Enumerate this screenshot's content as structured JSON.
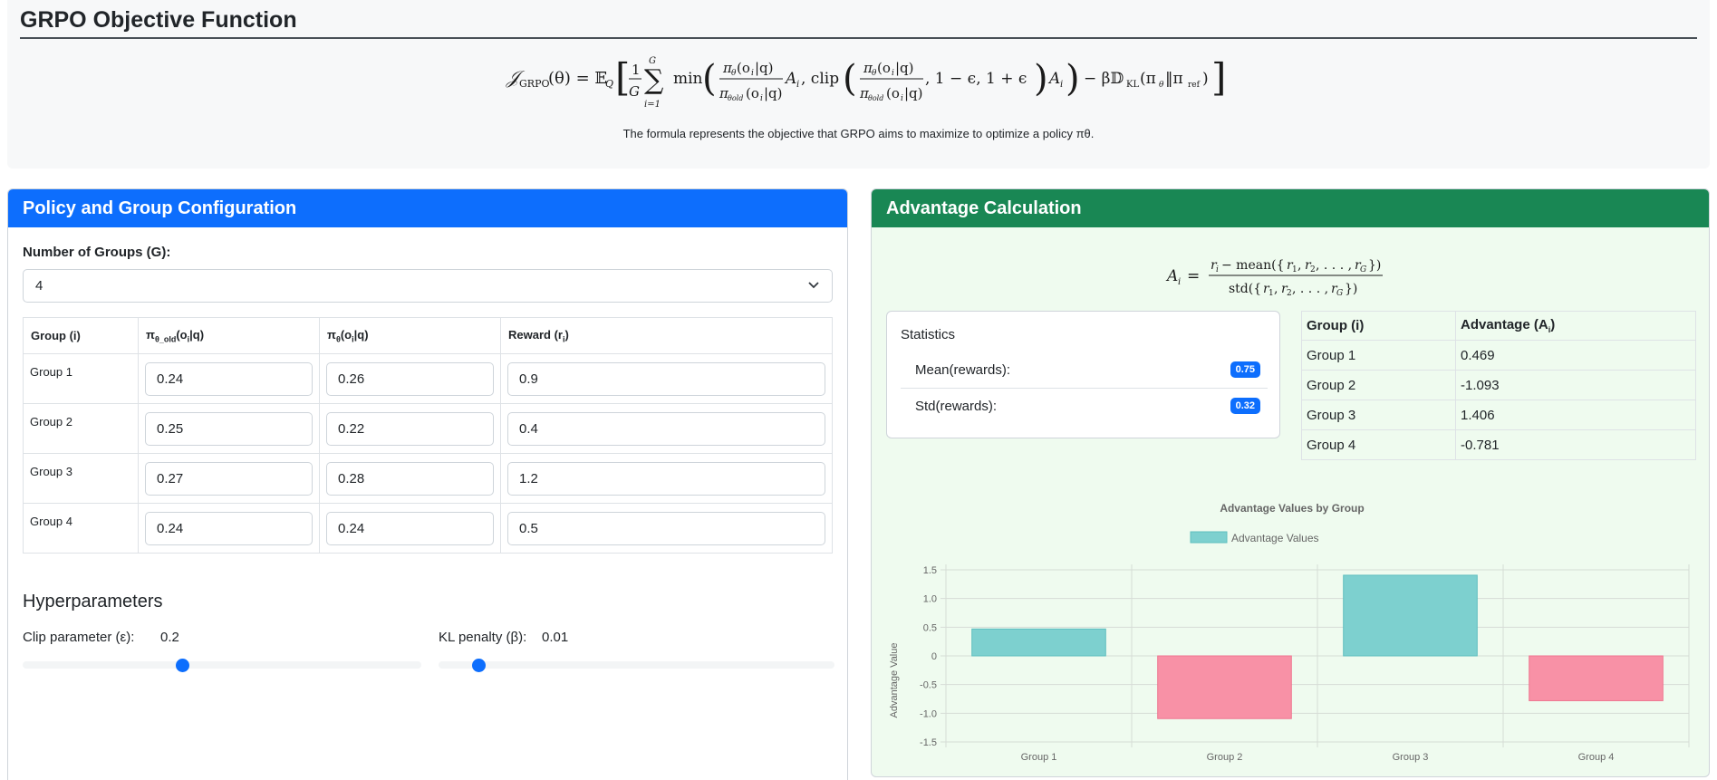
{
  "header": {
    "title": "GRPO Objective Function",
    "formula_text": "𝒥GRPO(θ) = 𝔼Q [ 1/G Σ min( πθ(oi|q)/πθold(oi|q) Ai, clip( πθ(oi|q)/πθold(oi|q), 1 − ε, 1 + ε ) Ai ) − β𝔻KL(πθ‖πref) ]",
    "caption": "The formula represents the objective that GRPO aims to maximize to optimize a policy πθ."
  },
  "policy": {
    "title": "Policy and Group Configuration",
    "groups_label": "Number of Groups (G):",
    "groups_value": "4",
    "columns": {
      "group": "Group (i)",
      "old_prefix": "π",
      "old_sub": "θ_old",
      "old_suffix": "(o",
      "old_sub2": "i",
      "old_end": "|q)",
      "new_prefix": "π",
      "new_sub": "θ",
      "new_suffix": "(o",
      "new_sub2": "i",
      "new_end": "|q)",
      "reward_prefix": "Reward (r",
      "reward_sub": "i",
      "reward_end": ")"
    },
    "rows": [
      {
        "name": "Group 1",
        "pi_old": "0.24",
        "pi_theta": "0.26",
        "reward": "0.9"
      },
      {
        "name": "Group 2",
        "pi_old": "0.25",
        "pi_theta": "0.22",
        "reward": "0.4"
      },
      {
        "name": "Group 3",
        "pi_old": "0.27",
        "pi_theta": "0.28",
        "reward": "1.2"
      },
      {
        "name": "Group 4",
        "pi_old": "0.24",
        "pi_theta": "0.24",
        "reward": "0.5"
      }
    ],
    "hyper_title": "Hyperparameters",
    "clip_label": "Clip parameter (ε):",
    "clip_value": "0.2",
    "clip_slider_fraction": 0.4,
    "kl_label": "KL penalty (β):",
    "kl_value": "0.01",
    "kl_slider_fraction": 0.1
  },
  "advantage": {
    "title": "Advantage Calculation",
    "formula_text": "Ai = (ri − mean({r1, r2, ..., rG})) / std({r1, r2, ..., rG})",
    "stats": {
      "title": "Statistics",
      "mean_label": "Mean(rewards):",
      "mean_value": "0.75",
      "std_label": "Std(rewards):",
      "std_value": "0.32"
    },
    "table": {
      "col_group": "Group (i)",
      "col_adv_prefix": "Advantage (A",
      "col_adv_sub": "i",
      "col_adv_end": ")",
      "rows": [
        {
          "group": "Group 1",
          "adv": "0.469"
        },
        {
          "group": "Group 2",
          "adv": "-1.093"
        },
        {
          "group": "Group 3",
          "adv": "1.406"
        },
        {
          "group": "Group 4",
          "adv": "-0.781"
        }
      ]
    }
  },
  "chart_data": {
    "type": "bar",
    "title": "Advantage Values by Group",
    "legend": "Advantage Values",
    "legend_position": "top",
    "categories": [
      "Group 1",
      "Group 2",
      "Group 3",
      "Group 4"
    ],
    "values": [
      0.469,
      -1.093,
      1.406,
      -0.781
    ],
    "xlabel": "",
    "ylabel": "Advantage Value",
    "ylim": [
      -1.5,
      1.5
    ],
    "yticks": [
      "1.5",
      "1.0",
      "0.5",
      "0",
      "-0.5",
      "-1.0",
      "-1.5"
    ],
    "grid": true,
    "colors": {
      "positive": "#7dd0cf",
      "positive_border": "#5fbfbf",
      "negative": "#f891a6",
      "negative_border": "#ef7590"
    }
  },
  "colors": {
    "primary": "#0d6efd",
    "success": "#198754",
    "right_panel_bg": "#effbef"
  }
}
